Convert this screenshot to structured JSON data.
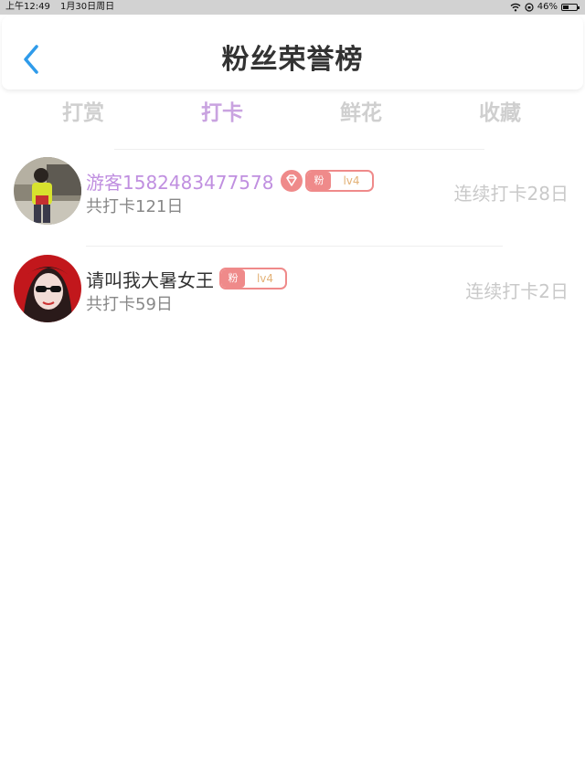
{
  "status_bar": {
    "time": "上午12:49",
    "date": "1月30日周日",
    "battery": "46%",
    "battery_level": 0.46
  },
  "header": {
    "title": "粉丝荣誉榜"
  },
  "tabs": [
    {
      "label": "打赏",
      "active": false
    },
    {
      "label": "打卡",
      "active": true
    },
    {
      "label": "鲜花",
      "active": false
    },
    {
      "label": "收藏",
      "active": false
    }
  ],
  "rows": [
    {
      "name": "游客1582483477578",
      "total": "共打卡121日",
      "badge_fan": "粉",
      "badge_level": "lv4",
      "streak": "连续打卡28日",
      "has_diamond": true
    },
    {
      "name": "请叫我大暑女王",
      "total": "共打卡59日",
      "badge_fan": "粉",
      "badge_level": "lv4",
      "streak": "连续打卡2日",
      "has_diamond": false
    }
  ],
  "colors": {
    "accent_purple": "#c9a3e0",
    "badge_red": "#ef8a8a",
    "back_blue": "#2f9bea"
  }
}
